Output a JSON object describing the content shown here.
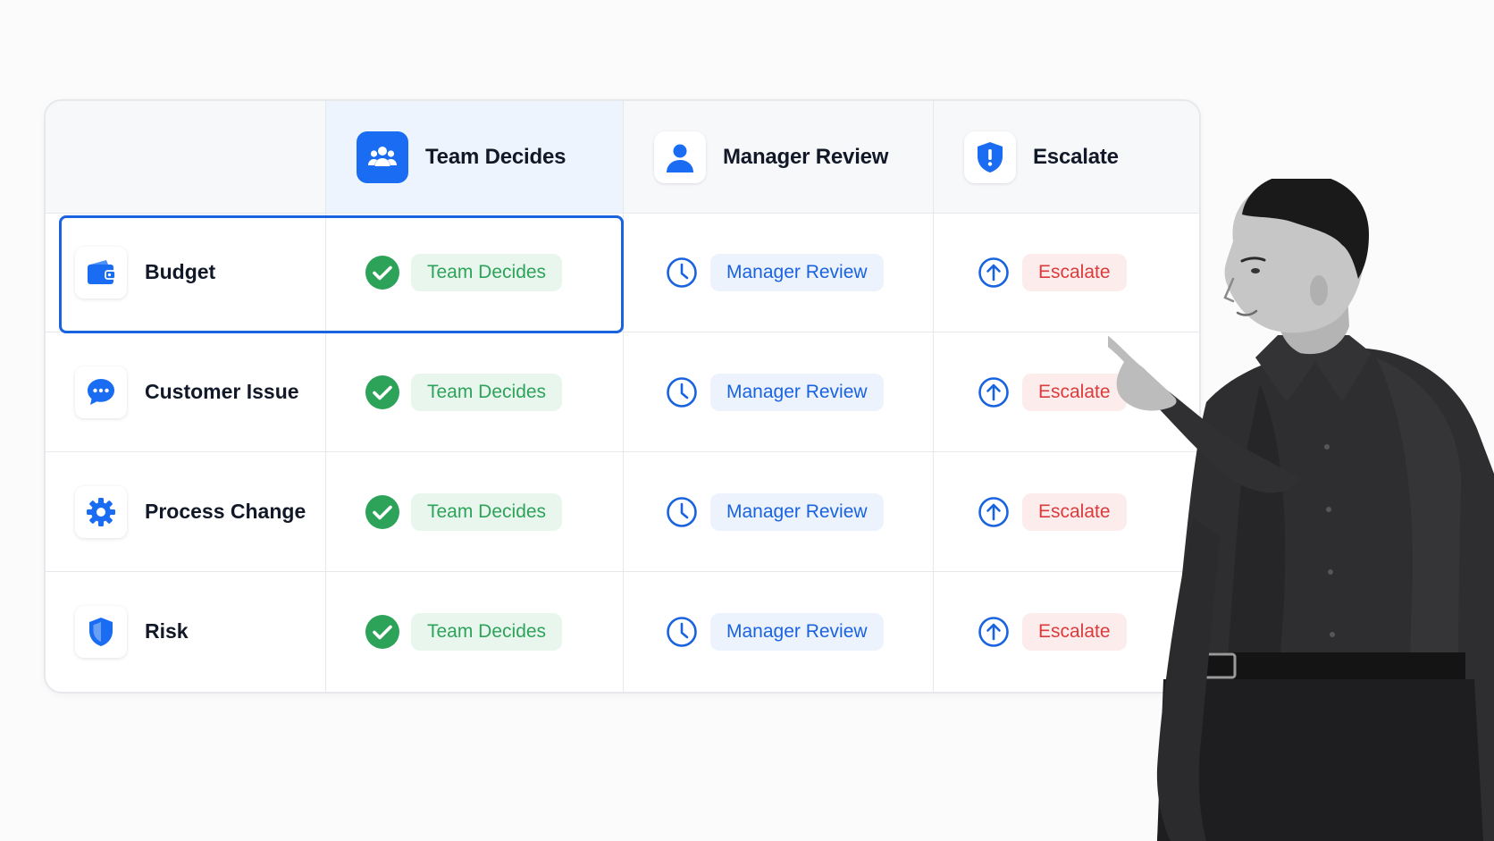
{
  "header": {
    "columns": [
      {
        "label": "Team Decides",
        "icon": "team-icon"
      },
      {
        "label": "Manager Review",
        "icon": "person-icon"
      },
      {
        "label": "Escalate",
        "icon": "shield-alert-icon"
      }
    ]
  },
  "rows": [
    {
      "label": "Budget",
      "icon": "wallet-icon",
      "team": "Team Decides",
      "manager": "Manager Review",
      "escalate": "Escalate",
      "highlighted": true
    },
    {
      "label": "Customer Issue",
      "icon": "chat-bubble-icon",
      "team": "Team Decides",
      "manager": "Manager Review",
      "escalate": "Escalate"
    },
    {
      "label": "Process Change",
      "icon": "gear-icon",
      "team": "Team Decides",
      "manager": "Manager Review",
      "escalate": "Escalate"
    },
    {
      "label": "Risk",
      "icon": "shield-icon",
      "team": "Team Decides",
      "manager": "Manager Review",
      "escalate": "Escalate"
    }
  ],
  "colors": {
    "accent_blue": "#1a6df2",
    "green": "#2da35a",
    "green_bg": "#e9f6ee",
    "blue_text": "#1a63e0",
    "blue_bg": "#edf3fd",
    "red": "#dc3b3b",
    "red_bg": "#fdecec"
  }
}
